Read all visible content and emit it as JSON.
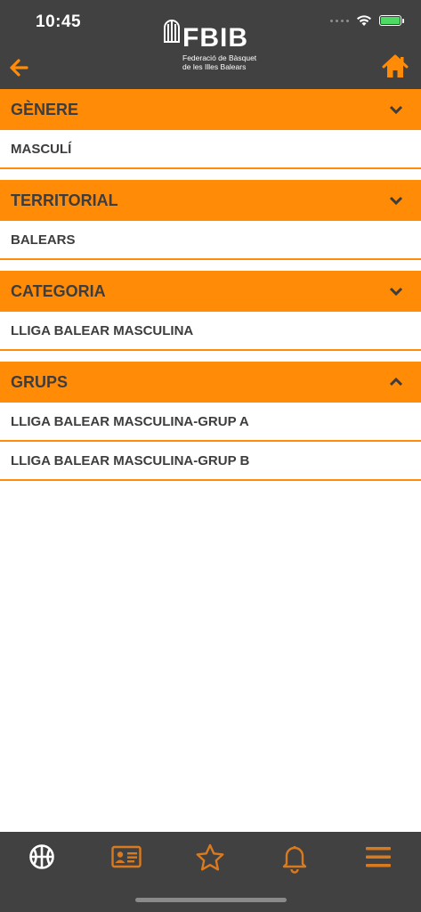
{
  "status_bar": {
    "time": "10:45"
  },
  "header": {
    "logo_text": "FBIB",
    "logo_sub_line1": "Federació de Bàsquet",
    "logo_sub_line2": "de les Illes Balears",
    "back_icon": "arrow-left-icon",
    "home_icon": "home-icon"
  },
  "sections": [
    {
      "title": "GÈNERE",
      "expanded": false,
      "items": [
        "MASCULÍ"
      ]
    },
    {
      "title": "TERRITORIAL",
      "expanded": false,
      "items": [
        "BALEARS"
      ]
    },
    {
      "title": "CATEGORIA",
      "expanded": false,
      "items": [
        "LLIGA BALEAR MASCULINA"
      ]
    },
    {
      "title": "GRUPS",
      "expanded": true,
      "items": [
        "LLIGA BALEAR MASCULINA-GRUP A",
        "LLIGA BALEAR MASCULINA-GRUP B"
      ]
    }
  ],
  "tabbar": {
    "tabs": [
      "basketball-icon",
      "id-card-icon",
      "star-icon",
      "bell-icon",
      "menu-icon"
    ],
    "active_tab": "basketball-icon"
  },
  "colors": {
    "accent": "#ff8b07",
    "header_bg": "#414141",
    "text": "#3d3d3d"
  }
}
